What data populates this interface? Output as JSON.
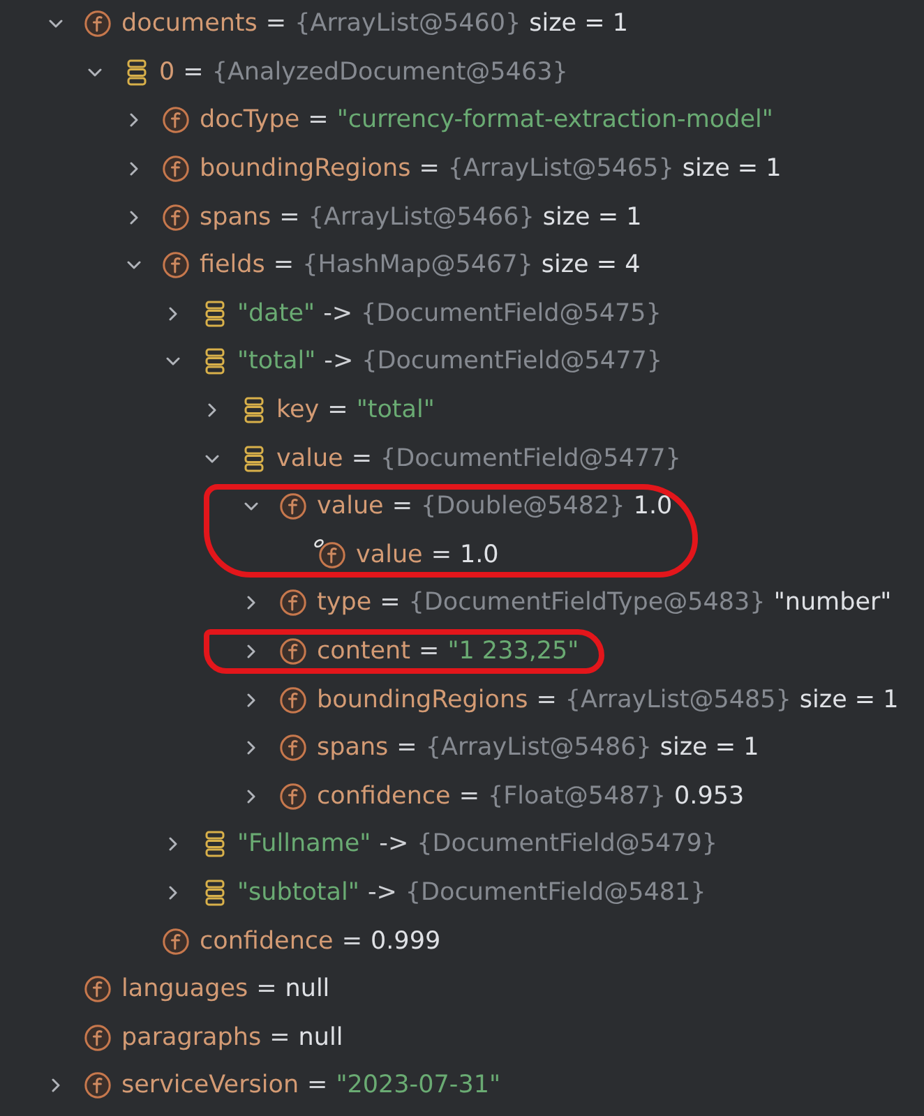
{
  "variables": [
    {
      "name": "documents",
      "kind": "field",
      "operator": "=",
      "ref": "{ArrayList@5460}",
      "value": "size = 1",
      "value_is_string": false,
      "expandable": true,
      "expanded": true,
      "circled": false,
      "children": [
        {
          "name": "0",
          "kind": "element",
          "operator": "=",
          "ref": "{AnalyzedDocument@5463}",
          "expandable": true,
          "expanded": true,
          "circled": false,
          "children": [
            {
              "name": "docType",
              "kind": "field",
              "operator": "=",
              "value": "\"currency-format-extraction-model\"",
              "value_is_string": true,
              "expandable": true,
              "expanded": false,
              "circled": false
            },
            {
              "name": "boundingRegions",
              "kind": "field",
              "operator": "=",
              "ref": "{ArrayList@5465}",
              "value": "size = 1",
              "value_is_string": false,
              "expandable": true,
              "expanded": false,
              "circled": false
            },
            {
              "name": "spans",
              "kind": "field",
              "operator": "=",
              "ref": "{ArrayList@5466}",
              "value": "size = 1",
              "value_is_string": false,
              "expandable": true,
              "expanded": false,
              "circled": false
            },
            {
              "name": "fields",
              "kind": "field",
              "operator": "=",
              "ref": "{HashMap@5467}",
              "value": "size = 4",
              "value_is_string": false,
              "expandable": true,
              "expanded": true,
              "circled": false,
              "children": [
                {
                  "name": "\"date\"",
                  "kind": "pair",
                  "operator": "->",
                  "ref": "{DocumentField@5475}",
                  "expandable": true,
                  "expanded": false,
                  "circled": false
                },
                {
                  "name": "\"total\"",
                  "kind": "pair",
                  "operator": "->",
                  "ref": "{DocumentField@5477}",
                  "expandable": true,
                  "expanded": true,
                  "circled": false,
                  "children": [
                    {
                      "name": "key",
                      "kind": "element",
                      "operator": "=",
                      "value": "\"total\"",
                      "value_is_string": true,
                      "expandable": true,
                      "expanded": false,
                      "circled": false
                    },
                    {
                      "name": "value",
                      "kind": "element",
                      "operator": "=",
                      "ref": "{DocumentField@5477}",
                      "expandable": true,
                      "expanded": true,
                      "circled": false,
                      "children": [
                        {
                          "name": "value",
                          "kind": "field",
                          "operator": "=",
                          "ref": "{Double@5482}",
                          "value": "1.0",
                          "value_is_string": false,
                          "expandable": true,
                          "expanded": true,
                          "circled": true,
                          "children": [
                            {
                              "name": "value",
                              "kind": "ringed",
                              "operator": "=",
                              "value": "1.0",
                              "value_is_string": false,
                              "expandable": false,
                              "circled": false
                            }
                          ]
                        },
                        {
                          "name": "type",
                          "kind": "field",
                          "operator": "=",
                          "ref": "{DocumentFieldType@5483}",
                          "value": "\"number\"",
                          "value_is_string": false,
                          "expandable": true,
                          "expanded": false,
                          "circled": false
                        },
                        {
                          "name": "content",
                          "kind": "field",
                          "operator": "=",
                          "value": "\"1 233,25\"",
                          "value_is_string": true,
                          "expandable": true,
                          "expanded": false,
                          "circled": true
                        },
                        {
                          "name": "boundingRegions",
                          "kind": "field",
                          "operator": "=",
                          "ref": "{ArrayList@5485}",
                          "value": "size = 1",
                          "value_is_string": false,
                          "expandable": true,
                          "expanded": false,
                          "circled": false
                        },
                        {
                          "name": "spans",
                          "kind": "field",
                          "operator": "=",
                          "ref": "{ArrayList@5486}",
                          "value": "size = 1",
                          "value_is_string": false,
                          "expandable": true,
                          "expanded": false,
                          "circled": false
                        },
                        {
                          "name": "confidence",
                          "kind": "field",
                          "operator": "=",
                          "ref": "{Float@5487}",
                          "value": "0.953",
                          "value_is_string": false,
                          "expandable": true,
                          "expanded": false,
                          "circled": false
                        }
                      ]
                    }
                  ]
                },
                {
                  "name": "\"Fullname\"",
                  "kind": "pair",
                  "operator": "->",
                  "ref": "{DocumentField@5479}",
                  "expandable": true,
                  "expanded": false,
                  "circled": false
                },
                {
                  "name": "\"subtotal\"",
                  "kind": "pair",
                  "operator": "->",
                  "ref": "{DocumentField@5481}",
                  "expandable": true,
                  "expanded": false,
                  "circled": false
                }
              ]
            },
            {
              "name": "confidence",
              "kind": "field",
              "operator": "=",
              "value": "0.999",
              "value_is_string": false,
              "expandable": false,
              "circled": false
            }
          ]
        }
      ]
    },
    {
      "name": "languages",
      "kind": "field",
      "operator": "=",
      "value": "null",
      "value_is_string": false,
      "expandable": false,
      "circled": false
    },
    {
      "name": "paragraphs",
      "kind": "field",
      "operator": "=",
      "value": "null",
      "value_is_string": false,
      "expandable": false,
      "circled": false
    },
    {
      "name": "serviceVersion",
      "kind": "field",
      "operator": "=",
      "value": "\"2023-07-31\"",
      "value_is_string": true,
      "expandable": true,
      "expanded": false,
      "circled": false
    }
  ]
}
